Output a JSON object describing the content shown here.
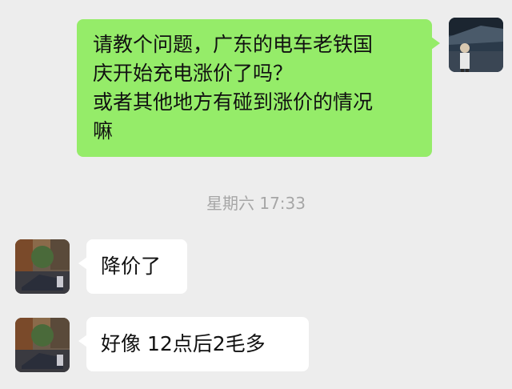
{
  "chat": {
    "messages": [
      {
        "sender": "self",
        "text": "请教个问题，广东的电车老铁国\n庆开始充电涨价了吗？\n或者其他地方有碰到涨价的情况\n嘛"
      },
      {
        "sender": "other",
        "text": "降价了"
      },
      {
        "sender": "other",
        "text": "好像 12点后2毛多"
      }
    ],
    "timestamp": "星期六 17:33"
  },
  "colors": {
    "background": "#ededed",
    "outgoing_bubble": "#95ec69",
    "incoming_bubble": "#ffffff",
    "timestamp_text": "#a6a6a6"
  }
}
